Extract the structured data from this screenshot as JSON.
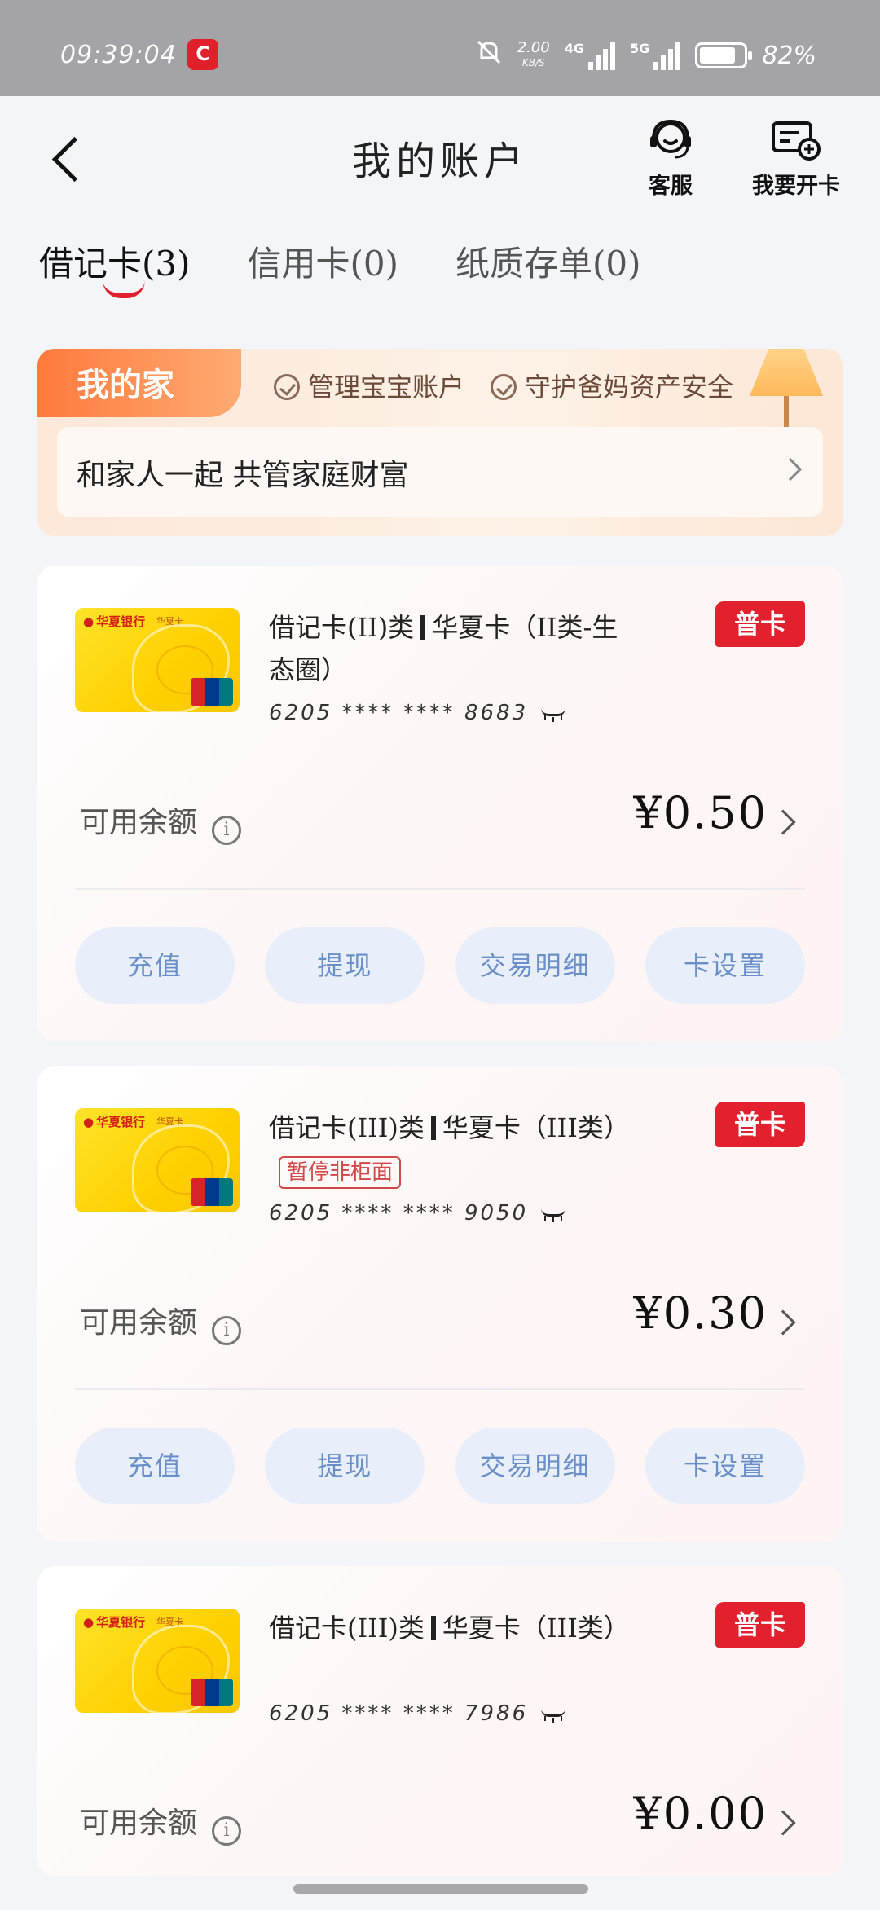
{
  "status_bar": {
    "time": "09:39:04",
    "app_badge": "C",
    "net_speed": "2.00",
    "net_speed_unit": "KB/S",
    "signal_1": "4G",
    "signal_2": "5G",
    "battery": "82%"
  },
  "header": {
    "title": "我的账户",
    "service_label": "客服",
    "open_card_label": "我要开卡"
  },
  "tabs": [
    {
      "label": "借记卡(3)",
      "active": true
    },
    {
      "label": "信用卡(0)",
      "active": false
    },
    {
      "label": "纸质存单(0)",
      "active": false
    }
  ],
  "family": {
    "badge": "我的家",
    "tags": [
      "管理宝宝账户",
      "守护爸妈资产安全"
    ],
    "row_text": "和家人一起 共管家庭财富"
  },
  "cards": [
    {
      "name_a": "借记卡(II)类",
      "name_b": "华夏卡（II类-生态圈）",
      "pause_tag": "",
      "number": "6205 **** **** 8683",
      "type_badge": "普卡",
      "balance_label": "可用余额",
      "balance": "¥0.50"
    },
    {
      "name_a": "借记卡(III)类",
      "name_b": "华夏卡（III类）",
      "pause_tag": "暂停非柜面",
      "number": "6205 **** **** 9050",
      "type_badge": "普卡",
      "balance_label": "可用余额",
      "balance": "¥0.30"
    },
    {
      "name_a": "借记卡(III)类",
      "name_b": "华夏卡（III类）",
      "pause_tag": "",
      "number": "6205 **** **** 7986",
      "type_badge": "普卡",
      "balance_label": "可用余额",
      "balance": "¥0.00"
    }
  ],
  "bank_card_face": {
    "bank_name": "华夏银行",
    "product": "华夏卡"
  },
  "card_actions": [
    "充值",
    "提现",
    "交易明细",
    "卡设置"
  ],
  "colors": {
    "brand_red": "#e2202e",
    "accent_orange": "#ff7a3d",
    "action_blue": "#6a8fc8"
  }
}
